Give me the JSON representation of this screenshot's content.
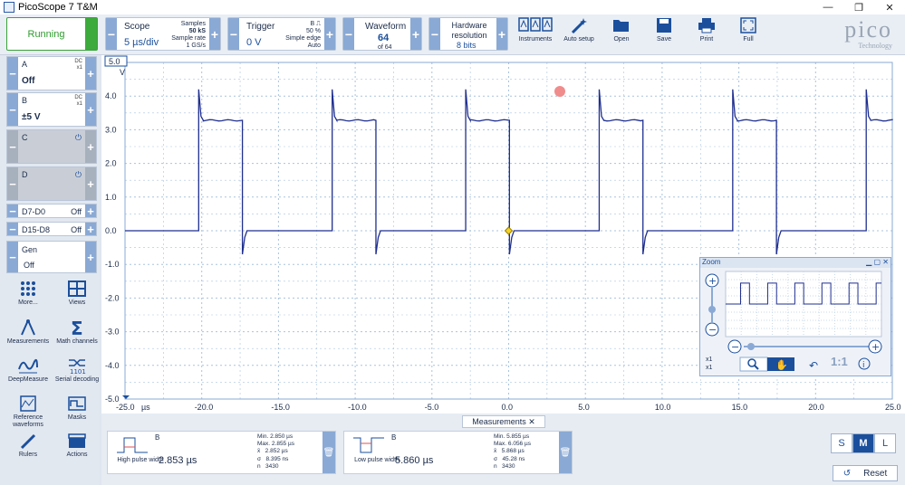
{
  "window": {
    "title": "PicoScope 7 T&M",
    "controls": [
      "—",
      "❐",
      "✕"
    ]
  },
  "toolbar": {
    "status": "Running",
    "scope": {
      "caption": "Scope",
      "value": "5 µs/div",
      "samples_label": "Samples",
      "samples": "50 kS",
      "rate_label": "Sample rate",
      "rate": "1 GS/s"
    },
    "trigger": {
      "caption": "Trigger",
      "value": "0 V",
      "channel": "B",
      "percent": "50 %",
      "type": "Simple edge",
      "mode": "Auto"
    },
    "waveform": {
      "caption": "Waveform",
      "value": "64",
      "of": "of 64"
    },
    "hwres": {
      "caption": "Hardware resolution",
      "value": "8 bits"
    },
    "tools": [
      "Instruments",
      "Auto setup",
      "Open",
      "Save",
      "Print",
      "Full"
    ],
    "logo": "pico",
    "logo_sub": "Technology"
  },
  "channels": [
    {
      "name": "A",
      "coupling": "DC",
      "probe": "x1",
      "range": "Off",
      "enabled": true
    },
    {
      "name": "B",
      "coupling": "DC",
      "probe": "x1",
      "range": "±5 V",
      "enabled": true
    },
    {
      "name": "C",
      "enabled": false
    },
    {
      "name": "D",
      "enabled": false
    }
  ],
  "digital": [
    {
      "name": "D7-D0",
      "state": "Off"
    },
    {
      "name": "D15-D8",
      "state": "Off"
    }
  ],
  "gen": {
    "name": "Gen",
    "state": "Off"
  },
  "left_tools": [
    "More...",
    "Views",
    "Measurements",
    "Math channels",
    "DeepMeasure",
    "Serial decoding",
    "Reference waveforms",
    "Masks",
    "Rulers",
    "Actions"
  ],
  "plot": {
    "y_unit": "V",
    "y_scale": "5.0",
    "y_ticks": [
      "4.0",
      "3.0",
      "2.0",
      "1.0",
      "0.0",
      "-1.0",
      "-2.0",
      "-3.0",
      "-4.0",
      "-5.0"
    ],
    "x_unit": "µs",
    "x_ticks": [
      "-25.0",
      "-20.0",
      "-15.0",
      "-10.0",
      "-5.0",
      "0.0",
      "5.0",
      "10.0",
      "15.0",
      "20.0",
      "25.0"
    ],
    "trace_color": "#1f2f8f"
  },
  "zoom": {
    "title": "Zoom",
    "factor": "1:1",
    "scale1": "x1",
    "scale2": "x1"
  },
  "measurements": {
    "tab": "Measurements",
    "cards": [
      {
        "channel": "B",
        "name": "High pulse width",
        "value": "2.853 µs",
        "min": "2.850 µs",
        "max": "2.855 µs",
        "mean": "2.852 µs",
        "sigma": "8.395 ns",
        "n": "3430"
      },
      {
        "channel": "B",
        "name": "Low pulse width",
        "value": "5.860 µs",
        "min": "5.855 µs",
        "max": "6.056 µs",
        "mean": "5.868 µs",
        "sigma": "45.28 ns",
        "n": "3430"
      }
    ],
    "stat_labels": [
      "Min.",
      "Max.",
      "x̄",
      "σ",
      "n"
    ]
  },
  "size_buttons": [
    "S",
    "M",
    "L"
  ],
  "active_size": "M",
  "reset_label": "Reset"
}
